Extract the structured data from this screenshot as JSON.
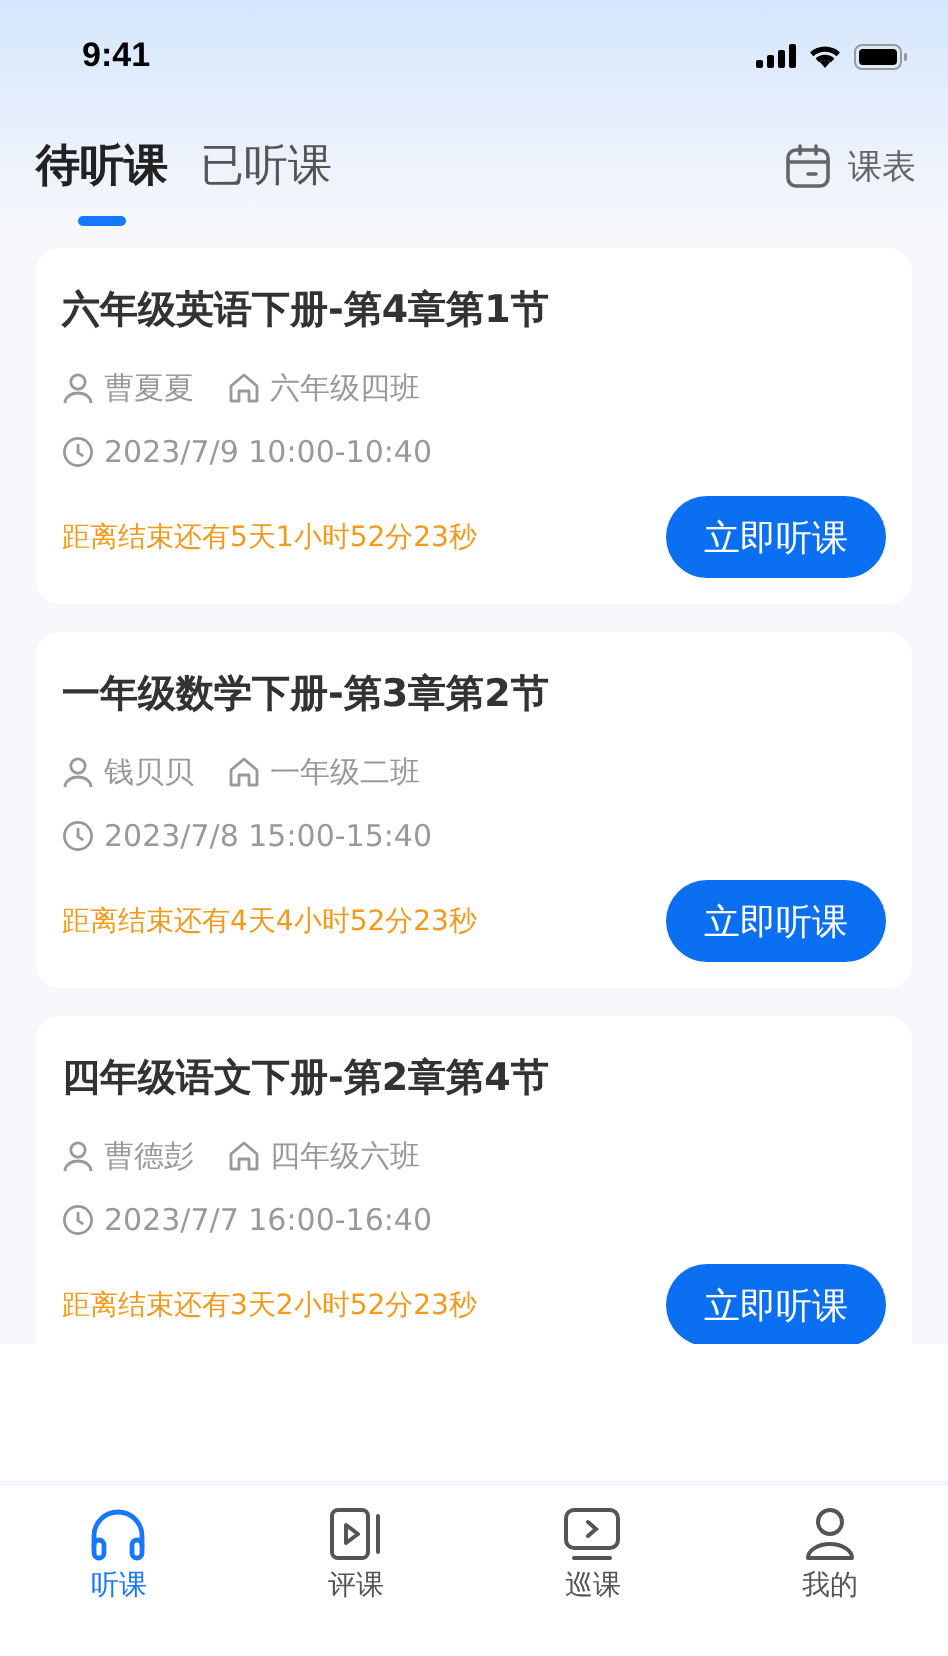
{
  "status_bar": {
    "time": "9:41"
  },
  "tabs": [
    {
      "label": "待听课",
      "selected": true
    },
    {
      "label": "已听课",
      "selected": false
    }
  ],
  "schedule_button": {
    "label": "课表"
  },
  "lessons": [
    {
      "title": "六年级英语下册-第4章第1节",
      "teacher": "曹夏夏",
      "class": "六年级四班",
      "time": "2023/7/9 10:00-10:40",
      "countdown": "距离结束还有5天1小时52分23秒",
      "action": "立即听课"
    },
    {
      "title": "一年级数学下册-第3章第2节",
      "teacher": "钱贝贝",
      "class": "一年级二班",
      "time": "2023/7/8 15:00-15:40",
      "countdown": "距离结束还有4天4小时52分23秒",
      "action": "立即听课"
    },
    {
      "title": "四年级语文下册-第2章第4节",
      "teacher": "曹德彭",
      "class": "四年级六班",
      "time": "2023/7/7 16:00-16:40",
      "countdown": "距离结束还有3天2小时52分23秒",
      "action": "立即听课"
    }
  ],
  "bottom_nav": [
    {
      "label": "听课",
      "kind": "headphones",
      "selected": true
    },
    {
      "label": "评课",
      "kind": "video",
      "selected": false
    },
    {
      "label": "巡课",
      "kind": "monitor",
      "selected": false
    },
    {
      "label": "我的",
      "kind": "person",
      "selected": false
    }
  ]
}
